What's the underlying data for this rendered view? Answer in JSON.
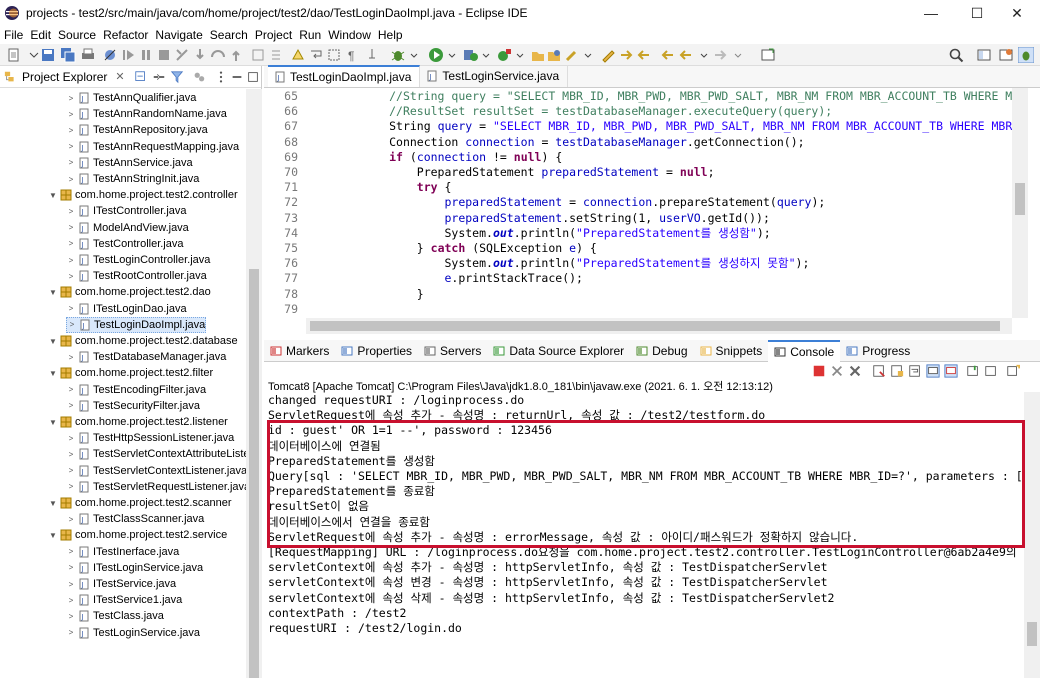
{
  "window": {
    "title": "projects - test2/src/main/java/com/home/project/test2/dao/TestLoginDaoImpl.java - Eclipse IDE",
    "minimize": "—",
    "maximize": "☐",
    "close": "✕"
  },
  "menu": [
    "File",
    "Edit",
    "Source",
    "Refactor",
    "Navigate",
    "Search",
    "Project",
    "Run",
    "Window",
    "Help"
  ],
  "project_explorer": {
    "title": "Project Explorer",
    "rows": [
      {
        "label": "TestAnnQualifier.java",
        "kind": "java",
        "selected": false
      },
      {
        "label": "TestAnnRandomName.java",
        "kind": "java",
        "selected": false
      },
      {
        "label": "TestAnnRepository.java",
        "kind": "java",
        "selected": false
      },
      {
        "label": "TestAnnRequestMapping.java",
        "kind": "java",
        "selected": false
      },
      {
        "label": "TestAnnService.java",
        "kind": "java",
        "selected": false
      },
      {
        "label": "TestAnnStringInit.java",
        "kind": "java",
        "selected": false
      },
      {
        "label": "com.home.project.test2.controller",
        "kind": "package",
        "selected": false
      },
      {
        "label": "ITestController.java",
        "kind": "java",
        "selected": false
      },
      {
        "label": "ModelAndView.java",
        "kind": "java",
        "selected": false
      },
      {
        "label": "TestController.java",
        "kind": "java",
        "selected": false
      },
      {
        "label": "TestLoginController.java",
        "kind": "java",
        "selected": false
      },
      {
        "label": "TestRootController.java",
        "kind": "java",
        "selected": false
      },
      {
        "label": "com.home.project.test2.dao",
        "kind": "package",
        "selected": false
      },
      {
        "label": "ITestLoginDao.java",
        "kind": "java",
        "selected": false
      },
      {
        "label": "TestLoginDaoImpl.java",
        "kind": "java",
        "selected": true
      },
      {
        "label": "com.home.project.test2.database",
        "kind": "package",
        "selected": false
      },
      {
        "label": "TestDatabaseManager.java",
        "kind": "java",
        "selected": false
      },
      {
        "label": "com.home.project.test2.filter",
        "kind": "package",
        "selected": false
      },
      {
        "label": "TestEncodingFilter.java",
        "kind": "java",
        "selected": false
      },
      {
        "label": "TestSecurityFilter.java",
        "kind": "java",
        "selected": false
      },
      {
        "label": "com.home.project.test2.listener",
        "kind": "package",
        "selected": false
      },
      {
        "label": "TestHttpSessionListener.java",
        "kind": "java",
        "selected": false
      },
      {
        "label": "TestServletContextAttributeListe",
        "kind": "java",
        "selected": false
      },
      {
        "label": "TestServletContextListener.java",
        "kind": "java",
        "selected": false
      },
      {
        "label": "TestServletRequestListener.java",
        "kind": "java",
        "selected": false
      },
      {
        "label": "com.home.project.test2.scanner",
        "kind": "package",
        "selected": false
      },
      {
        "label": "TestClassScanner.java",
        "kind": "java",
        "selected": false
      },
      {
        "label": "com.home.project.test2.service",
        "kind": "package",
        "selected": false
      },
      {
        "label": "ITestInerface.java",
        "kind": "java",
        "selected": false
      },
      {
        "label": "ITestLoginService.java",
        "kind": "java",
        "selected": false
      },
      {
        "label": "ITestService.java",
        "kind": "java",
        "selected": false
      },
      {
        "label": "ITestService1.java",
        "kind": "java",
        "selected": false
      },
      {
        "label": "TestClass.java",
        "kind": "java",
        "selected": false
      },
      {
        "label": "TestLoginService.java",
        "kind": "java",
        "selected": false
      }
    ]
  },
  "editor": {
    "tabs": [
      {
        "label": "TestLoginDaoImpl.java",
        "active": true
      },
      {
        "label": "TestLoginService.java",
        "active": false
      }
    ],
    "lines": [
      {
        "num": "65",
        "indent": "            ",
        "parts": [
          {
            "c": "cm",
            "t": "//String query = \"SELECT MBR_ID, MBR_PWD, MBR_PWD_SALT, MBR_NM FROM MBR_ACCOUNT_TB WHERE MBR_"
          }
        ]
      },
      {
        "num": "66",
        "indent": "            ",
        "parts": [
          {
            "c": "cm",
            "t": "//ResultSet resultSet = testDatabaseManager.executeQuery(query);"
          }
        ]
      },
      {
        "num": "67",
        "indent": "            ",
        "parts": [
          {
            "c": "",
            "t": "String "
          },
          {
            "c": "fd",
            "t": "query"
          },
          {
            "c": "",
            "t": " = "
          },
          {
            "c": "st",
            "t": "\"SELECT MBR_ID, MBR_PWD, MBR_PWD_SALT, MBR_NM FROM MBR_ACCOUNT_TB WHERE MBR_ID"
          }
        ]
      },
      {
        "num": "68",
        "indent": "            ",
        "parts": [
          {
            "c": "",
            "t": "Connection "
          },
          {
            "c": "fd",
            "t": "connection"
          },
          {
            "c": "",
            "t": " = "
          },
          {
            "c": "fd",
            "t": "testDatabaseManager"
          },
          {
            "c": "",
            "t": ".getConnection();"
          }
        ]
      },
      {
        "num": "69",
        "indent": "            ",
        "parts": [
          {
            "c": "kw",
            "t": "if"
          },
          {
            "c": "",
            "t": " ("
          },
          {
            "c": "fd",
            "t": "connection"
          },
          {
            "c": "",
            "t": " != "
          },
          {
            "c": "kw",
            "t": "null"
          },
          {
            "c": "",
            "t": ") {"
          }
        ]
      },
      {
        "num": "70",
        "indent": "                ",
        "parts": [
          {
            "c": "",
            "t": "PreparedStatement "
          },
          {
            "c": "fd",
            "t": "preparedStatement"
          },
          {
            "c": "",
            "t": " = "
          },
          {
            "c": "kw",
            "t": "null"
          },
          {
            "c": "",
            "t": ";"
          }
        ]
      },
      {
        "num": "71",
        "indent": "                ",
        "parts": [
          {
            "c": "kw",
            "t": "try"
          },
          {
            "c": "",
            "t": " {"
          }
        ]
      },
      {
        "num": "72",
        "indent": "                    ",
        "parts": [
          {
            "c": "fd",
            "t": "preparedStatement"
          },
          {
            "c": "",
            "t": " = "
          },
          {
            "c": "fd",
            "t": "connection"
          },
          {
            "c": "",
            "t": ".prepareStatement("
          },
          {
            "c": "fd",
            "t": "query"
          },
          {
            "c": "",
            "t": ");"
          }
        ]
      },
      {
        "num": "73",
        "indent": "                    ",
        "parts": [
          {
            "c": "fd",
            "t": "preparedStatement"
          },
          {
            "c": "",
            "t": ".setString(1, "
          },
          {
            "c": "fd",
            "t": "userVO"
          },
          {
            "c": "",
            "t": ".getId());"
          }
        ]
      },
      {
        "num": "74",
        "indent": "                    ",
        "parts": [
          {
            "c": "",
            "t": "System."
          },
          {
            "c": "sf",
            "t": "out"
          },
          {
            "c": "",
            "t": ".println("
          },
          {
            "c": "st",
            "t": "\"PreparedStatement를 생성함\""
          },
          {
            "c": "",
            "t": ");"
          }
        ]
      },
      {
        "num": "75",
        "indent": "                ",
        "parts": [
          {
            "c": "",
            "t": "} "
          },
          {
            "c": "kw",
            "t": "catch"
          },
          {
            "c": "",
            "t": " (SQLException "
          },
          {
            "c": "fd",
            "t": "e"
          },
          {
            "c": "",
            "t": ") {"
          }
        ]
      },
      {
        "num": "76",
        "indent": "                    ",
        "parts": [
          {
            "c": "",
            "t": "System."
          },
          {
            "c": "sf",
            "t": "out"
          },
          {
            "c": "",
            "t": ".println("
          },
          {
            "c": "st",
            "t": "\"PreparedStatement를 생성하지 못함\""
          },
          {
            "c": "",
            "t": ");"
          }
        ]
      },
      {
        "num": "77",
        "indent": "                    ",
        "parts": [
          {
            "c": "fd",
            "t": "e"
          },
          {
            "c": "",
            "t": ".printStackTrace();"
          }
        ]
      },
      {
        "num": "78",
        "indent": "                ",
        "parts": [
          {
            "c": "",
            "t": "}"
          }
        ]
      },
      {
        "num": "79",
        "indent": "",
        "parts": []
      }
    ]
  },
  "views": {
    "tabs": [
      {
        "label": "Markers",
        "active": false
      },
      {
        "label": "Properties",
        "active": false
      },
      {
        "label": "Servers",
        "active": false
      },
      {
        "label": "Data Source Explorer",
        "active": false
      },
      {
        "label": "Debug",
        "active": false
      },
      {
        "label": "Snippets",
        "active": false
      },
      {
        "label": "Console",
        "active": true
      },
      {
        "label": "Progress",
        "active": false
      }
    ]
  },
  "console": {
    "description": "Tomcat8 [Apache Tomcat] C:\\Program Files\\Java\\jdk1.8.0_181\\bin\\javaw.exe  (2021. 6. 1. 오전 12:13:12)",
    "lines": [
      "changed requestURI : /loginprocess.do",
      "ServletRequest에 속성 추가 - 속성명 : returnUrl, 속성 값 : /test2/testform.do",
      "id : guest' OR 1=1 --', password : 123456",
      "데이터베이스에 연결됨",
      "PreparedStatement를 생성함",
      "Query[sql : 'SELECT MBR_ID, MBR_PWD, MBR_PWD_SALT, MBR_NM FROM MBR_ACCOUNT_TB WHERE MBR_ID=?', parameters : ['gu",
      "PreparedStatement를 종료함",
      "resultSet이 없음",
      "데이터베이스에서 연결을 종료함",
      "ServletRequest에 속성 추가 - 속성명 : errorMessage, 속성 값 : 아이디/패스워드가 정확하지 않습니다.",
      "[RequestMapping] URL : /loginprocess.do요청을 com.home.project.test2.controller.TestLoginController@6ab2a4e9의 log",
      "servletContext에 속성 추가 - 속성명 : httpServletInfo, 속성 값 : TestDispatcherServlet",
      "servletContext에 속성 변경 - 속성명 : httpServletInfo, 속성 값 : TestDispatcherServlet",
      "servletContext에 속성 삭제 - 속성명 : httpServletInfo, 속성 값 : TestDispatcherServlet2",
      "contextPath : /test2",
      "requestURI : /test2/login.do"
    ]
  },
  "colors": {
    "highlight_box": "#c8102e",
    "comment": "#3f7f5f",
    "keyword": "#7f0055",
    "string": "#2a00ff",
    "field": "#0000c0"
  }
}
